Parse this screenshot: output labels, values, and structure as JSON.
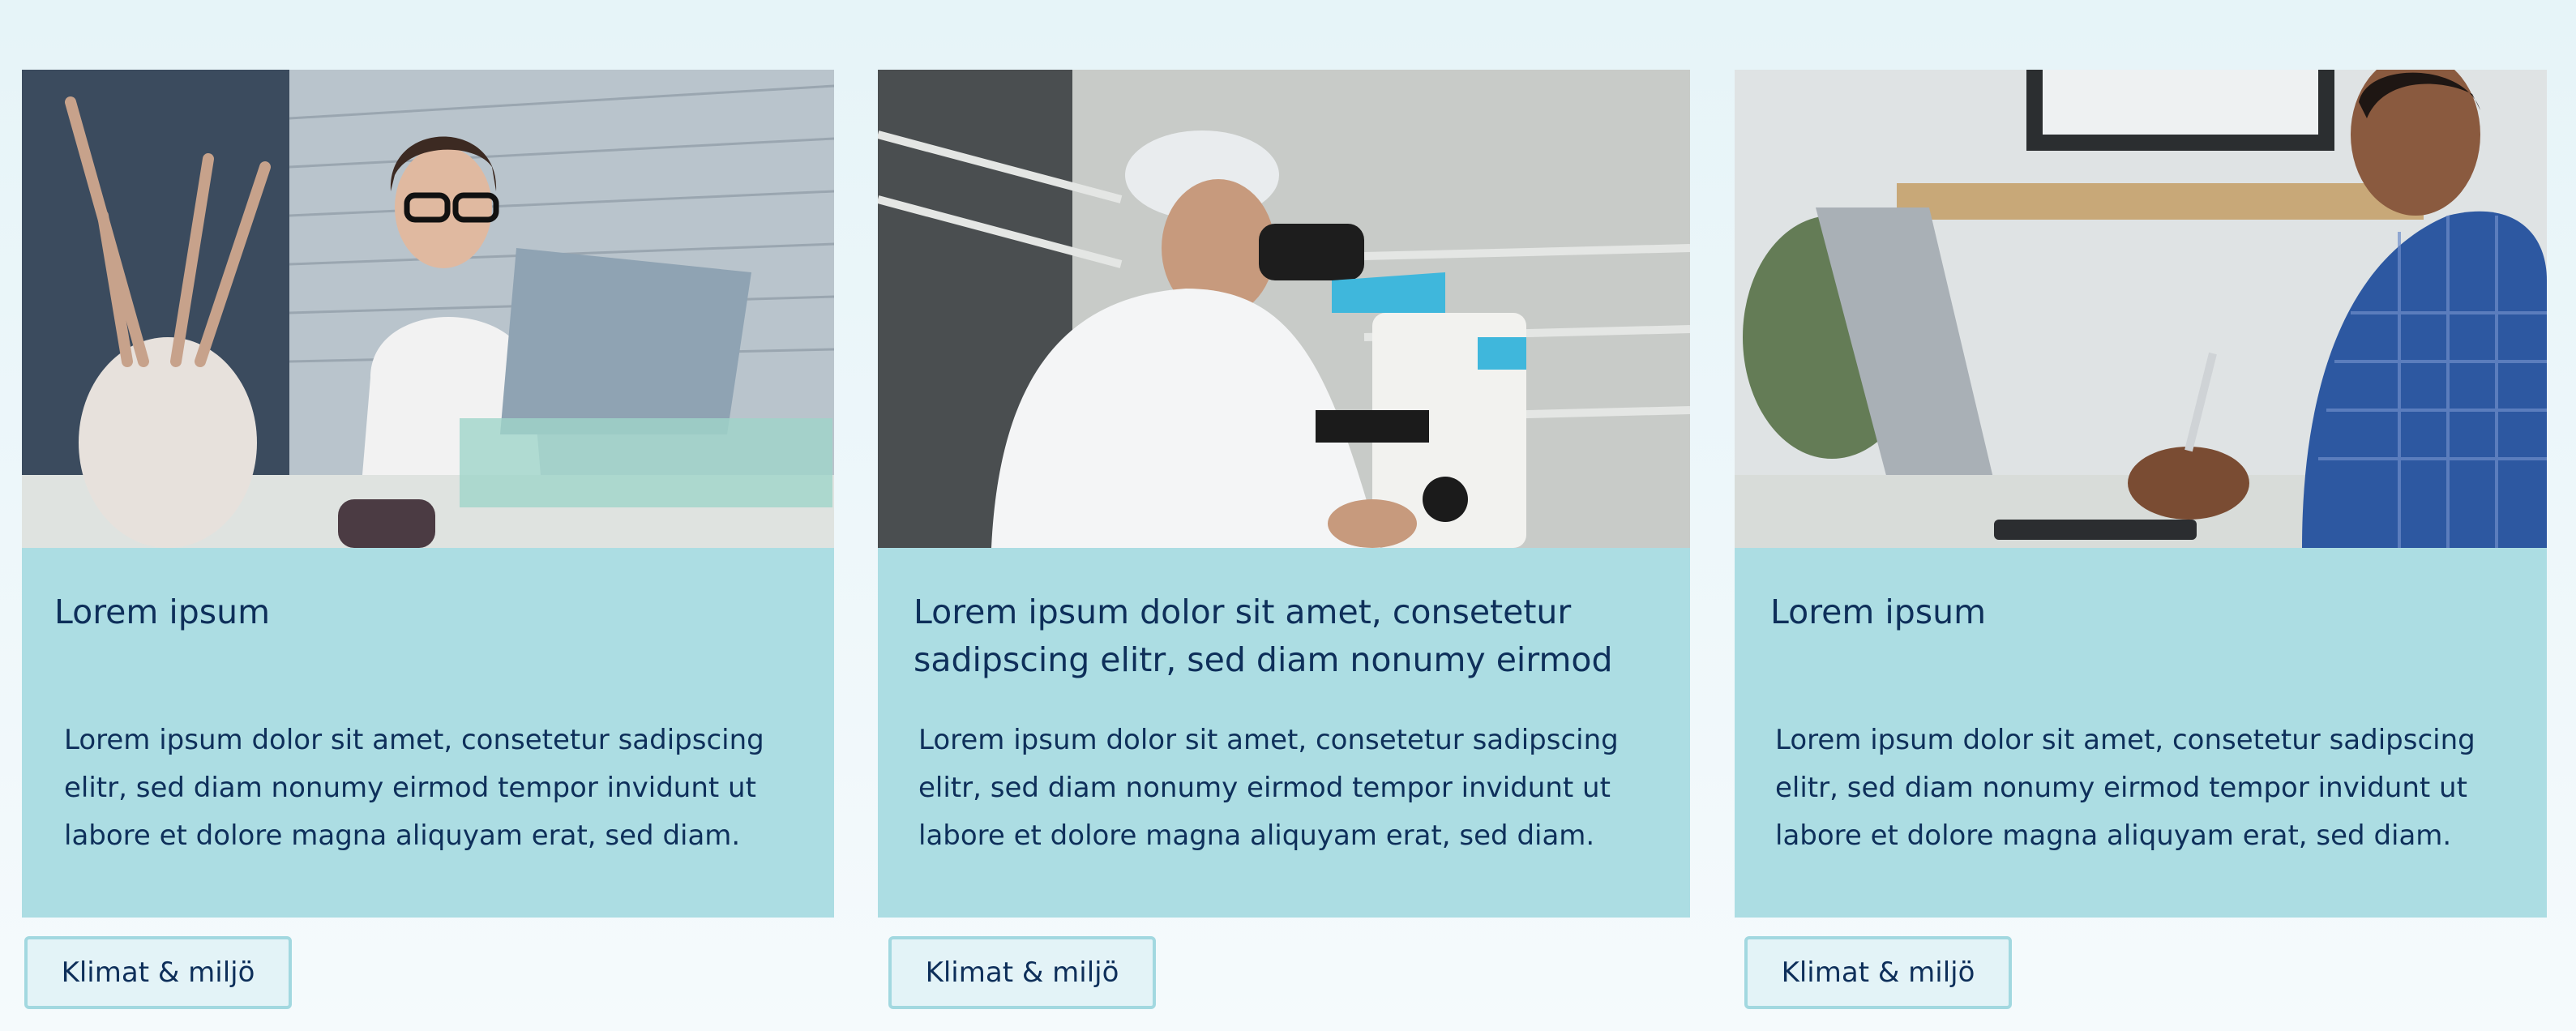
{
  "cards": [
    {
      "image_alt": "woman thinking at laptop",
      "title": "Lorem ipsum",
      "text": "Lorem ipsum dolor sit amet, consetetur sadipscing elitr, sed diam nonumy eirmod tempor invidunt ut labore et dolore magna aliquyam erat, sed diam.",
      "tag": "Klimat & miljö"
    },
    {
      "image_alt": "scientist using microscope",
      "title": "Lorem ipsum dolor sit amet, consetetur sadipscing elitr, sed diam nonumy eirmod",
      "text": "Lorem ipsum dolor sit amet, consetetur sadipscing elitr, sed diam nonumy eirmod tempor invidunt ut labore et dolore magna aliquyam erat, sed diam.",
      "tag": "Klimat & miljö"
    },
    {
      "image_alt": "man writing notes next to laptop",
      "title": "Lorem ipsum",
      "text": "Lorem ipsum dolor sit amet, consetetur sadipscing elitr, sed diam nonumy eirmod tempor invidunt ut labore et dolore magna aliquyam erat, sed diam.",
      "tag": "Klimat & miljö"
    }
  ],
  "colors": {
    "card_body": "#acdde3",
    "text": "#0e2f5a",
    "tag_border": "#a2d8e0",
    "tag_bg": "#e3f3f7",
    "page_bg": "#eef7fa"
  }
}
